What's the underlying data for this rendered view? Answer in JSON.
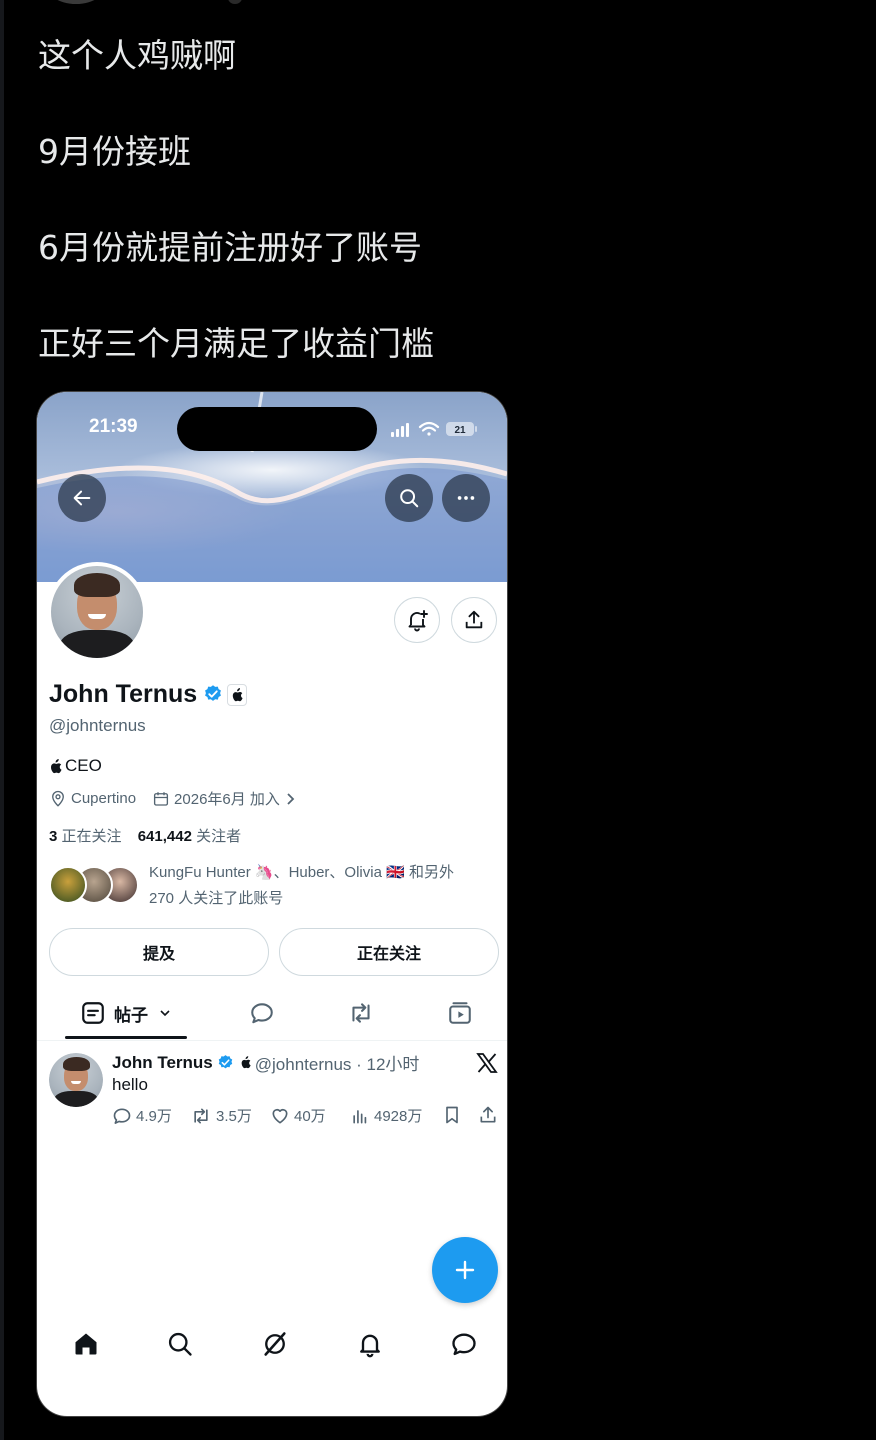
{
  "post": {
    "lines": [
      "这个人鸡贼啊",
      "9月份接班",
      "6月份就提前注册好了账号",
      "正好三个月满足了收益门槛"
    ]
  },
  "phone": {
    "status_time": "21:39",
    "battery": "21"
  },
  "profile": {
    "name": "John Ternus",
    "handle": "@johnternus",
    "bio": "CEO",
    "location": "Cupertino",
    "joined": "2026年6月 加入",
    "following_count": "3",
    "following_label": "正在关注",
    "followers_count": "641,442",
    "followers_label": "关注者",
    "followed_by_line1": "KungFu Hunter 🦄、Huber、Olivia 🇬🇧 和另外",
    "followed_by_line2": "270 人关注了此账号",
    "mention_button": "提及",
    "following_button": "正在关注"
  },
  "tabs": {
    "posts_label": "帖子"
  },
  "tweet": {
    "name": "John Ternus",
    "handle_time": "@johnternus · 12小时",
    "text": "hello",
    "replies": "4.9万",
    "retweets": "3.5万",
    "likes": "40万",
    "views": "4928万"
  },
  "icons": {
    "back": "arrow-left-icon",
    "search": "search-icon",
    "more": "more-horizontal-icon",
    "notify": "bell-plus-icon",
    "share": "share-icon",
    "location": "location-pin-icon",
    "calendar": "calendar-icon",
    "fab": "plus-icon",
    "nav": [
      "home-icon",
      "search-icon",
      "grok-icon",
      "bell-icon",
      "message-icon"
    ]
  },
  "colors": {
    "background": "#000000",
    "accent": "#1d9bf0",
    "text_primary": "#0f1419",
    "text_secondary": "#536471"
  }
}
